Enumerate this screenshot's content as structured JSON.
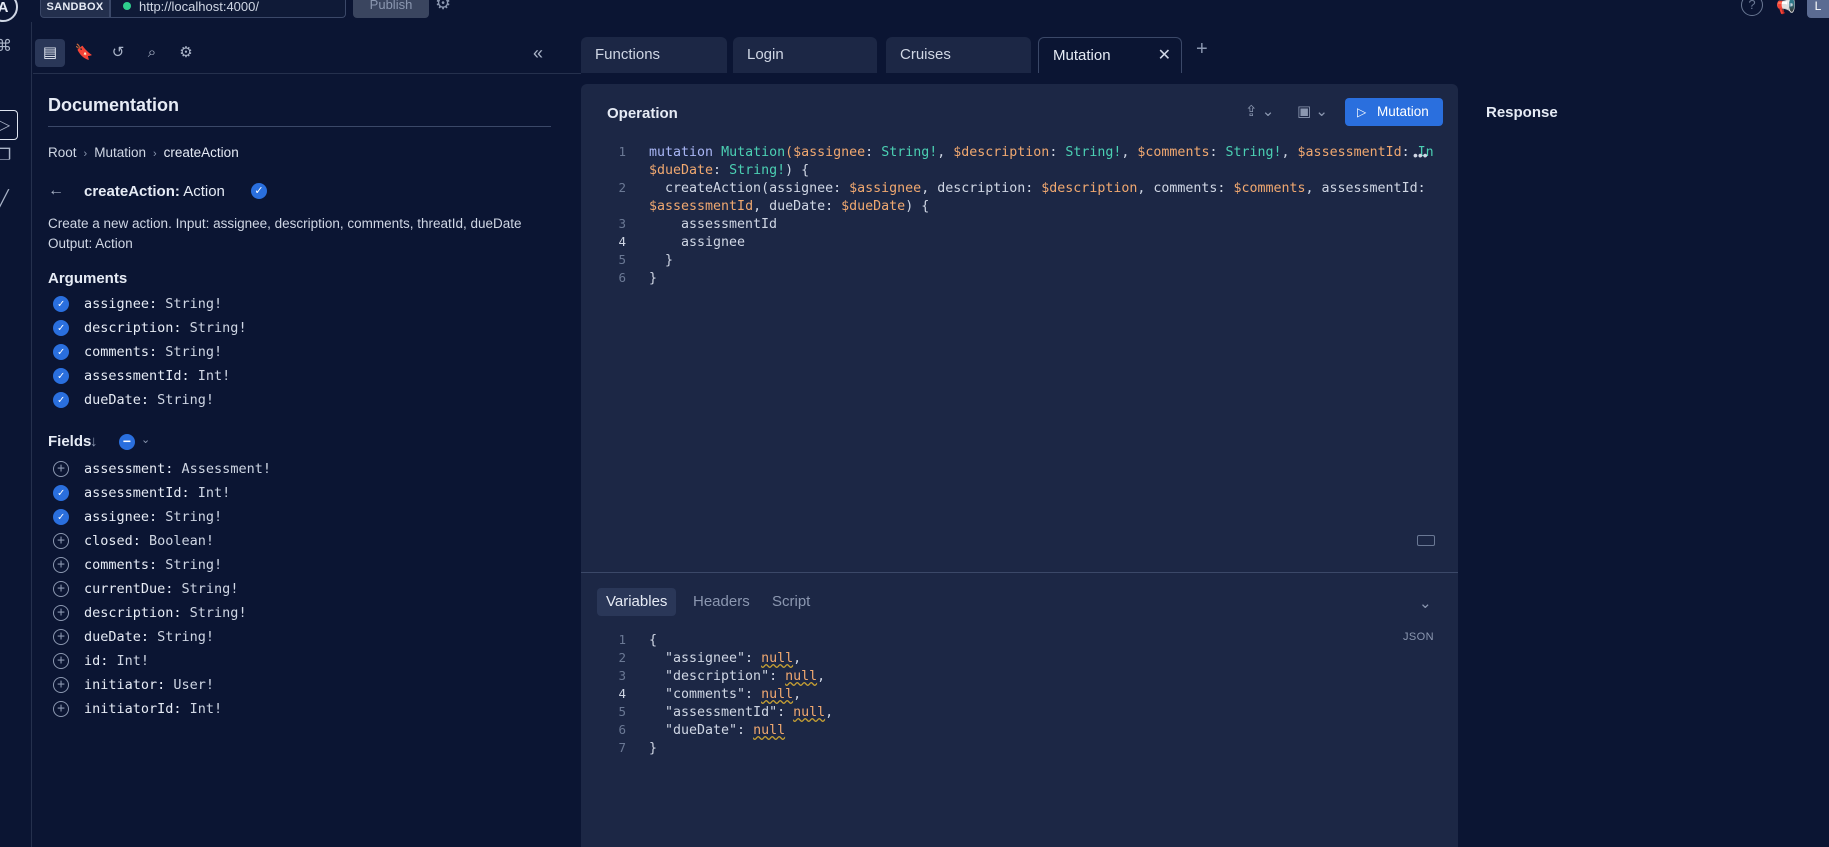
{
  "topbar": {
    "logo": "A",
    "sandbox_label": "SANDBOX",
    "url": "http://localhost:4000/",
    "publish_label": "Publish",
    "help_icon": "?",
    "user_initial": "L"
  },
  "doc": {
    "title": "Documentation",
    "breadcrumb": [
      "Root",
      "Mutation",
      "createAction"
    ],
    "field_name": "createAction:",
    "field_type": "Action",
    "description_line1": "Create a new action. Input: assignee, description, comments, threatId, dueDate",
    "description_line2": "Output: Action",
    "arguments_title": "Arguments",
    "arguments": [
      {
        "name": "assignee:",
        "type": "String!",
        "checked": true
      },
      {
        "name": "description:",
        "type": "String!",
        "checked": true
      },
      {
        "name": "comments:",
        "type": "String!",
        "checked": true
      },
      {
        "name": "assessmentId:",
        "type": "Int!",
        "checked": true
      },
      {
        "name": "dueDate:",
        "type": "String!",
        "checked": true
      }
    ],
    "fields_title": "Fields",
    "fields": [
      {
        "name": "assessment:",
        "type": "Assessment!",
        "checked": false
      },
      {
        "name": "assessmentId:",
        "type": "Int!",
        "checked": true
      },
      {
        "name": "assignee:",
        "type": "String!",
        "checked": true
      },
      {
        "name": "closed:",
        "type": "Boolean!",
        "checked": false
      },
      {
        "name": "comments:",
        "type": "String!",
        "checked": false
      },
      {
        "name": "currentDue:",
        "type": "String!",
        "checked": false
      },
      {
        "name": "description:",
        "type": "String!",
        "checked": false
      },
      {
        "name": "dueDate:",
        "type": "String!",
        "checked": false
      },
      {
        "name": "id:",
        "type": "Int!",
        "checked": false
      },
      {
        "name": "initiator:",
        "type": "User!",
        "checked": false
      },
      {
        "name": "initiatorId:",
        "type": "Int!",
        "checked": false
      }
    ]
  },
  "tabs": [
    "Functions",
    "Login",
    "Cruises",
    "Mutation"
  ],
  "operation": {
    "title": "Operation",
    "run_label": "Mutation",
    "line_numbers": [
      "1",
      "2",
      "3",
      "4",
      "5",
      "6"
    ],
    "l1": {
      "kw": "mutation",
      "name": "Mutation",
      "p1": "($assignee",
      "t1": "String!",
      "p2": "$description",
      "t2": "String!",
      "p3": "$comments",
      "t3": "String!",
      "p4": "$assessmentId",
      "t4": "In"
    },
    "l1b": {
      "p5": "$dueDate",
      "t5": "String!",
      "end": ") {"
    },
    "l2": {
      "fn": "createAction(assignee: ",
      "v1": "$assignee",
      "a2": ", description: ",
      "v2": "$description",
      "a3": ", comments: ",
      "v3": "$comments",
      "a4": ", assessmentId:"
    },
    "l2b": {
      "v4": "$assessmentId",
      "a5": ", dueDate: ",
      "v5": "$dueDate",
      "end": ") {"
    },
    "l3": "assessmentId",
    "l4": "assignee",
    "l5": "}",
    "l6": "}"
  },
  "variables": {
    "tabs": [
      "Variables",
      "Headers",
      "Script"
    ],
    "format_label": "JSON",
    "line_numbers": [
      "1",
      "2",
      "3",
      "4",
      "5",
      "6",
      "7"
    ],
    "open": "{",
    "rows": [
      {
        "key": "\"assignee\"",
        "val": "null",
        "end": ","
      },
      {
        "key": "\"description\"",
        "val": "null",
        "end": ","
      },
      {
        "key": "\"comments\"",
        "val": "null",
        "end": ","
      },
      {
        "key": "\"assessmentId\"",
        "val": "null",
        "end": ","
      },
      {
        "key": "\"dueDate\"",
        "val": "null",
        "end": ""
      }
    ],
    "close": "}"
  },
  "response": {
    "title": "Response"
  },
  "colors": {
    "accent": "#2a6fde",
    "background": "#0b1533",
    "panel": "#1c2745"
  }
}
